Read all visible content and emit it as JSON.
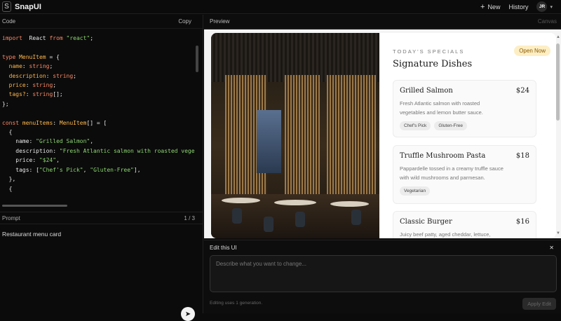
{
  "app": {
    "logo_glyph": "S",
    "name": "SnapUI"
  },
  "topnav": {
    "new_icon": "+",
    "new_label": "New",
    "history_label": "History",
    "avatar_initials": "JR",
    "caret": "▾"
  },
  "code_panel": {
    "title": "Code",
    "copy_label": "Copy",
    "lines": [
      [
        [
          "kw",
          "import"
        ],
        [
          "",
          "  React "
        ],
        [
          "kw",
          "from"
        ],
        [
          "str",
          " \"react\""
        ],
        [
          "",
          ";"
        ]
      ],
      [],
      [
        [
          "kw",
          "type"
        ],
        [
          "ty",
          " MenuItem"
        ],
        [
          "",
          " = {"
        ]
      ],
      [
        [
          "pr",
          "  name"
        ],
        [
          "",
          ": "
        ],
        [
          "kw",
          "string"
        ],
        [
          "",
          ";"
        ]
      ],
      [
        [
          "pr",
          "  description"
        ],
        [
          "",
          ": "
        ],
        [
          "kw",
          "string"
        ],
        [
          "",
          ";"
        ]
      ],
      [
        [
          "pr",
          "  price"
        ],
        [
          "",
          ": "
        ],
        [
          "kw",
          "string"
        ],
        [
          "",
          ";"
        ]
      ],
      [
        [
          "pr",
          "  tags?"
        ],
        [
          "",
          ": "
        ],
        [
          "kw",
          "string"
        ],
        [
          "",
          "[];"
        ]
      ],
      [
        [
          "",
          "};"
        ]
      ],
      [],
      [
        [
          "kw",
          "const"
        ],
        [
          "pr",
          " menuItems"
        ],
        [
          "",
          ": "
        ],
        [
          "ty",
          "MenuItem"
        ],
        [
          "",
          "[] = ["
        ]
      ],
      [
        [
          "",
          "  {"
        ]
      ],
      [
        [
          "",
          "    name: "
        ],
        [
          "str",
          "\"Grilled Salmon\""
        ],
        [
          "",
          ","
        ]
      ],
      [
        [
          "",
          "    description: "
        ],
        [
          "str",
          "\"Fresh Atlantic salmon with roasted vegetables"
        ]
      ],
      [
        [
          "",
          "    price: "
        ],
        [
          "str",
          "\"$24\""
        ],
        [
          "",
          ","
        ]
      ],
      [
        [
          "",
          "    tags: ["
        ],
        [
          "str",
          "\"Chef's Pick\""
        ],
        [
          "",
          ", "
        ],
        [
          "str",
          "\"Gluten-Free\""
        ],
        [
          "",
          "],"
        ]
      ],
      [
        [
          "",
          "  },"
        ]
      ],
      [
        [
          "",
          "  {"
        ]
      ]
    ]
  },
  "prompt_panel": {
    "title": "Prompt",
    "counter": "1 / 3",
    "text": "Restaurant menu card",
    "send_icon": "➤"
  },
  "preview": {
    "title": "Preview",
    "canvas_label": "Canvas",
    "card": {
      "eyebrow": "TODAY'S SPECIALS",
      "badge": "Open Now",
      "heading": "Signature Dishes",
      "dishes": [
        {
          "name": "Grilled Salmon",
          "price": "$24",
          "description": "Fresh Atlantic salmon with roasted vegetables and lemon butter sauce.",
          "tags": [
            "Chef's Pick",
            "Gluten-Free"
          ]
        },
        {
          "name": "Truffle Mushroom Pasta",
          "price": "$18",
          "description": "Pappardelle tossed in a creamy truffle sauce with wild mushrooms and parmesan.",
          "tags": [
            "Vegetarian"
          ]
        },
        {
          "name": "Classic Burger",
          "price": "$16",
          "description": "Juicy beef patty, aged cheddar, lettuce,",
          "tags": []
        }
      ]
    }
  },
  "edit_panel": {
    "title": "Edit this UI",
    "close_icon": "✕",
    "placeholder": "Describe what you want to change...",
    "footer_note": "Editing uses 1 generation.",
    "apply_label": "Apply Edit"
  }
}
